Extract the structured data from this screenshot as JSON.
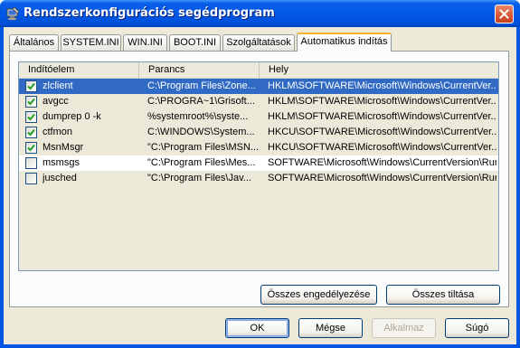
{
  "window": {
    "title": "Rendszerkonfigurációs segédprogram"
  },
  "tabs": [
    {
      "label": "Általános",
      "active": false
    },
    {
      "label": "SYSTEM.INI",
      "active": false
    },
    {
      "label": "WIN.INI",
      "active": false
    },
    {
      "label": "BOOT.INI",
      "active": false
    },
    {
      "label": "Szolgáltatások",
      "active": false
    },
    {
      "label": "Automatikus indítás",
      "active": true
    }
  ],
  "list": {
    "columns": [
      "Indítóelem",
      "Parancs",
      "Hely"
    ],
    "rows": [
      {
        "checked": true,
        "item": "zlclient",
        "command": "C:\\Program Files\\Zone...",
        "location": "HKLM\\SOFTWARE\\Microsoft\\Windows\\CurrentVer...",
        "state": "selected"
      },
      {
        "checked": true,
        "item": "avgcc",
        "command": "C:\\PROGRA~1\\Grisoft...",
        "location": "HKLM\\SOFTWARE\\Microsoft\\Windows\\CurrentVer...",
        "state": "normal"
      },
      {
        "checked": true,
        "item": "dumprep 0 -k",
        "command": "%systemroot%\\syste...",
        "location": "HKLM\\SOFTWARE\\Microsoft\\Windows\\CurrentVer...",
        "state": "normal"
      },
      {
        "checked": true,
        "item": "ctfmon",
        "command": "C:\\WINDOWS\\System...",
        "location": "HKCU\\SOFTWARE\\Microsoft\\Windows\\CurrentVer...",
        "state": "normal"
      },
      {
        "checked": true,
        "item": "MsnMsgr",
        "command": "\"C:\\Program Files\\MSN...",
        "location": "HKCU\\SOFTWARE\\Microsoft\\Windows\\CurrentVer...",
        "state": "normal"
      },
      {
        "checked": false,
        "item": "msmsgs",
        "command": "\"C:\\Program Files\\Mes...",
        "location": "SOFTWARE\\Microsoft\\Windows\\CurrentVersion\\Run",
        "state": "white"
      },
      {
        "checked": false,
        "item": "jusched",
        "command": "\"C:\\Program Files\\Jav...",
        "location": "SOFTWARE\\Microsoft\\Windows\\CurrentVersion\\Run",
        "state": "normal"
      }
    ]
  },
  "panel_buttons": {
    "enable_all": "Összes engedélyezése",
    "disable_all": "Összes tiltása"
  },
  "dialog_buttons": {
    "ok": "OK",
    "cancel": "Mégse",
    "apply": "Alkalmaz",
    "help": "Súgó"
  },
  "colors": {
    "title_bar": "#0058e6",
    "selection": "#316ac5",
    "active_tab_accent": "#f7b22d",
    "dialog_face": "#ece9d8"
  },
  "icons": {
    "title": "computer-tools-icon",
    "close": "close-icon",
    "check": "checkmark-icon"
  }
}
